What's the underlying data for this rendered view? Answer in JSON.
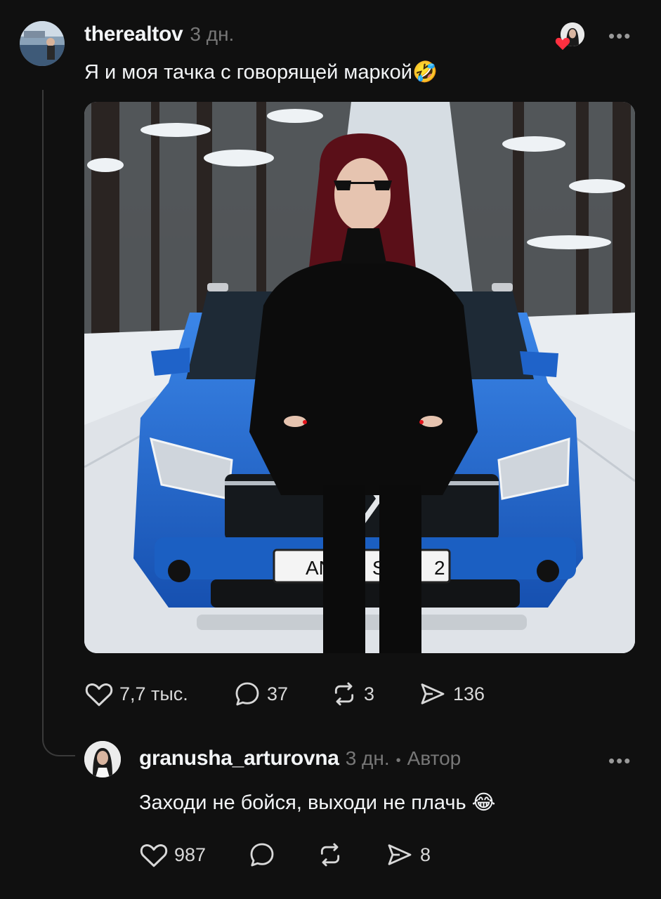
{
  "post": {
    "username": "therealtov",
    "time": "3 дн.",
    "text": "Я и моя тачка с говорящей маркой🤣",
    "more_label": "•••",
    "image_alt": "Девушка в чёрной шубе и солнцезащитных очках стоит перед синим автомобилем Renault в заснеженном лесу",
    "plate_text": "ANDRI ST",
    "plate_suffix": "2",
    "actions": {
      "likes": "7,7 тыс.",
      "comments": "37",
      "reposts": "3",
      "shares": "136"
    }
  },
  "reply": {
    "username": "granusha_arturovna",
    "time": "3 дн.",
    "separator": "•",
    "role": "Автор",
    "text": "Заходи не бойся, выходи не плачь 😂",
    "more_label": "•••",
    "actions": {
      "likes": "987",
      "comments": "",
      "reposts": "",
      "shares": "8"
    }
  },
  "colors": {
    "background": "#101010",
    "text_primary": "#f3f5f7",
    "text_secondary": "#777777",
    "like_heart": "#ff3040",
    "car_blue": "#1f63c9"
  }
}
